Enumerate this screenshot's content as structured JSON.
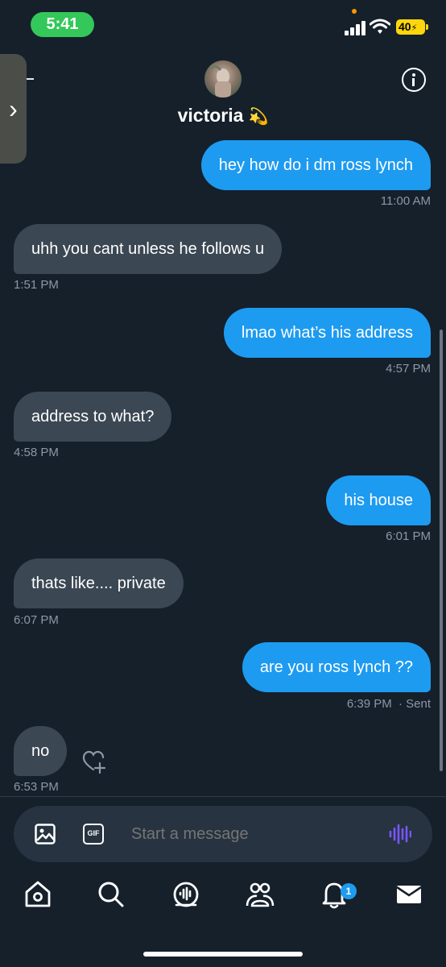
{
  "status_bar": {
    "time": "5:41",
    "battery": "40"
  },
  "header": {
    "contact_name": "victoria",
    "name_emoji": "💫"
  },
  "messages": [
    {
      "direction": "out",
      "text": "hey how do i dm ross lynch",
      "time": "11:00 AM"
    },
    {
      "direction": "in",
      "text": "uhh you cant unless he follows u",
      "time": "1:51 PM"
    },
    {
      "direction": "out",
      "text": "lmao what’s his address",
      "time": "4:57 PM"
    },
    {
      "direction": "in",
      "text": "address to what?",
      "time": "4:58 PM"
    },
    {
      "direction": "out",
      "text": "his house",
      "time": "6:01 PM"
    },
    {
      "direction": "in",
      "text": "thats like.... private",
      "time": "6:07 PM"
    },
    {
      "direction": "out",
      "text": "are you ross lynch ??",
      "time": "6:39 PM",
      "status": "· Sent"
    },
    {
      "direction": "in",
      "text": "no",
      "time": "6:53 PM"
    }
  ],
  "composer": {
    "placeholder": "Start a message",
    "gif_label": "GIF"
  },
  "tabbar": {
    "items": [
      "home-icon",
      "search-icon",
      "spaces-icon",
      "communities-icon",
      "notifications-icon",
      "messages-icon"
    ],
    "notification_count": "1"
  },
  "colors": {
    "background": "#15202b",
    "outgoing_bubble": "#1d9bf0",
    "incoming_bubble": "#3b4753",
    "timestamp": "#8b98a5",
    "voice_accent": "#7856ff"
  }
}
